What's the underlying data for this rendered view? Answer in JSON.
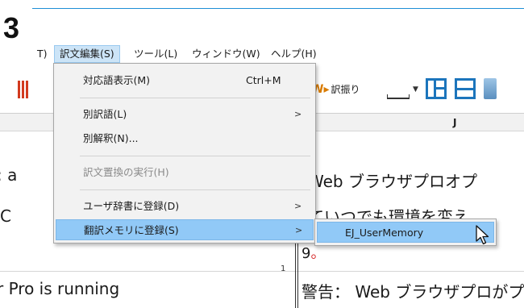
{
  "step_number": "3",
  "menubar": {
    "items": [
      {
        "label": "T)"
      },
      {
        "label": "訳文編集(S)",
        "active": true
      },
      {
        "label": "ツール(L)"
      },
      {
        "label": "ウィンドウ(W)"
      },
      {
        "label": "ヘルプ(H)"
      }
    ]
  },
  "toolbar": {
    "translate_label": "訳振り"
  },
  "grid": {
    "column_label": "J",
    "row_number": "1",
    "left_cells": [
      ": a",
      "C",
      "r Pro is running"
    ],
    "right_cells": [
      "Web ブラウザプロオプ",
      "ていつでも環境を変え",
      "9",
      "警告： Web ブラウザプロがプロ"
    ],
    "red_dot": "。"
  },
  "menu": {
    "items": [
      {
        "label": "対応語表示(M)",
        "shortcut": "Ctrl+M"
      },
      {
        "label": "別訳語(L)",
        "submenu": true
      },
      {
        "label": "別解釈(N)..."
      },
      {
        "label": "訳文置換の実行(H)",
        "disabled": true
      },
      {
        "label": "ユーザ辞書に登録(D)",
        "submenu": true
      },
      {
        "label": "翻訳メモリに登録(S)",
        "submenu": true,
        "highlighted": true
      }
    ],
    "submenu_arrow": ">"
  },
  "submenu": {
    "items": [
      {
        "label": "EJ_UserMemory",
        "highlighted": true
      }
    ]
  },
  "colors": {
    "accent": "#1e8fd6",
    "highlight": "#91c9f7",
    "menu_bg": "#f2f2f2",
    "icon_blue": "#1c75bc",
    "icon_red": "#d23a1e"
  }
}
